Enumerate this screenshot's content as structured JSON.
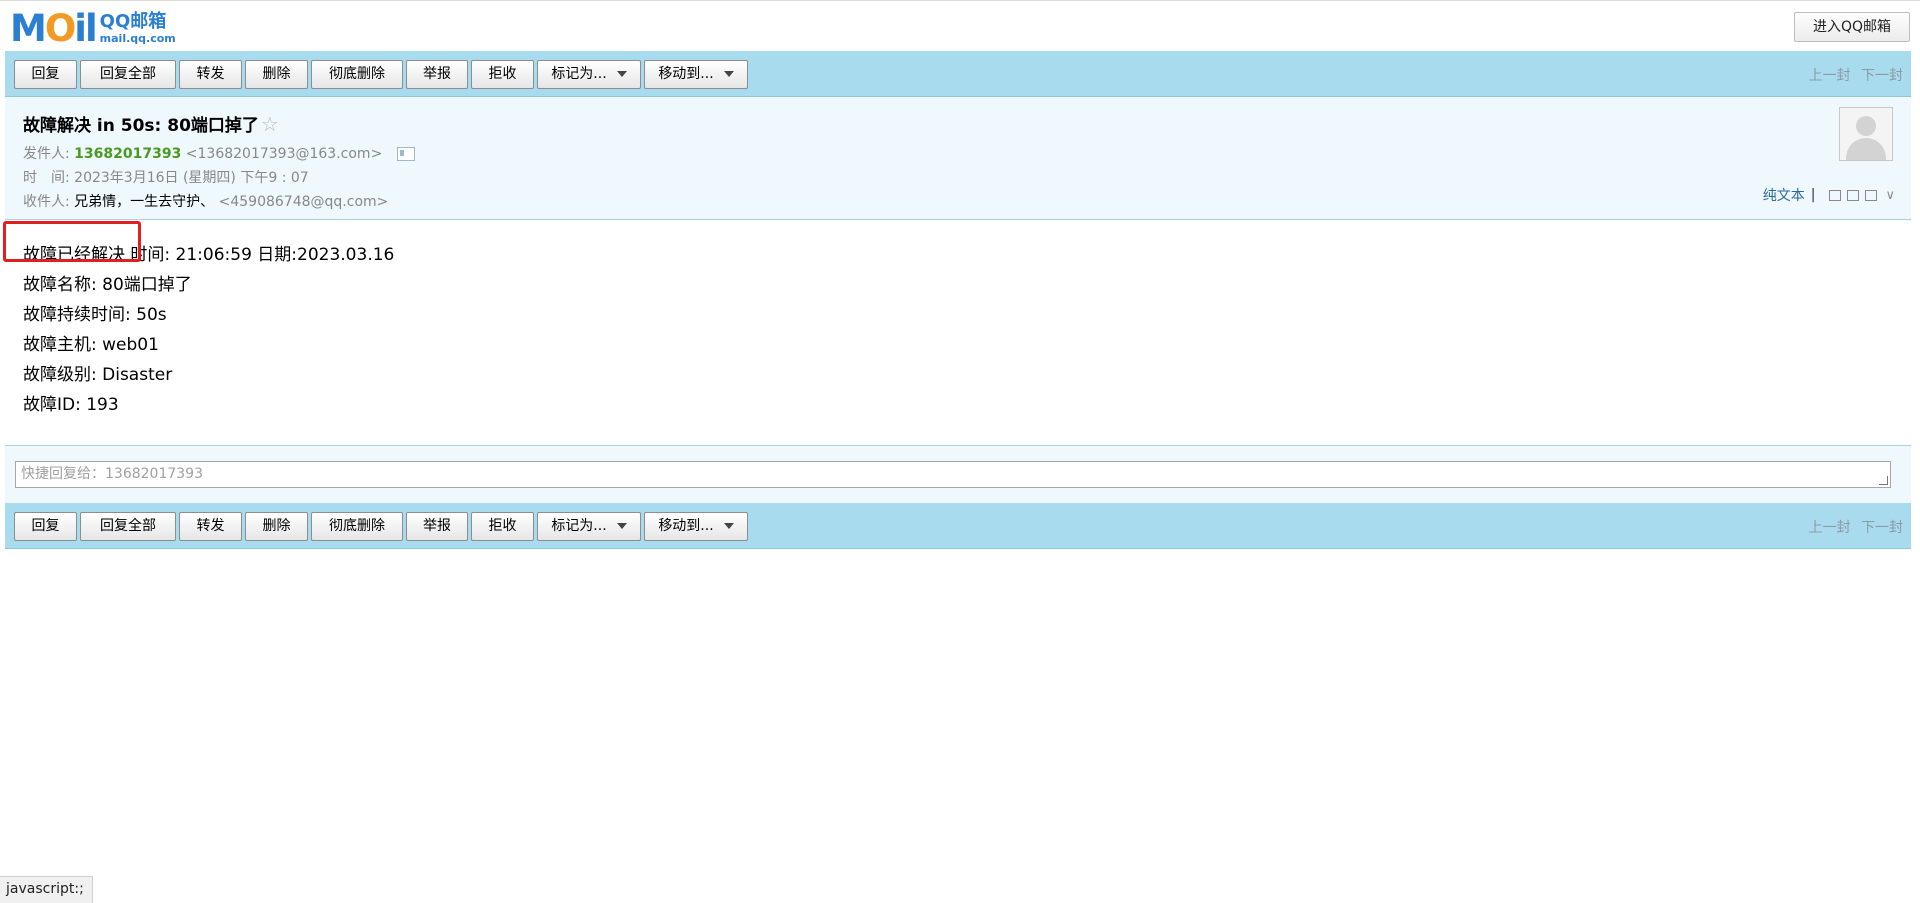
{
  "logo": {
    "text_a": "M",
    "text_o": "O",
    "text_b": "il",
    "qq": "QQ邮箱",
    "url": "mail.qq.com"
  },
  "enter_button": "进入QQ邮箱",
  "toolbar": {
    "reply": "回复",
    "reply_all": "回复全部",
    "forward": "转发",
    "delete": "删除",
    "delete_permanent": "彻底删除",
    "report": "举报",
    "reject": "拒收",
    "mark_as": "标记为...",
    "move_to": "移动到...",
    "prev": "上一封",
    "next": "下一封"
  },
  "mail": {
    "subject": "故障解决 in 50s: 80端口掉了",
    "star": "☆",
    "sender_label": "发件人:",
    "sender_name": "13682017393",
    "sender_email": "<13682017393@163.com>",
    "time_label": "时　间:",
    "time_value": "2023年3月16日 (星期四) 下午9 : 07",
    "recipient_label": "收件人:",
    "recipient_name": "兄弟情，一生去守护、",
    "recipient_email": "<459086748@qq.com>",
    "plain_text": "纯文本",
    "sep": "|"
  },
  "body_lines": {
    "line1": "故障已经解决 时间: 21:06:59 日期:2023.03.16",
    "line2": "故障名称: 80端口掉了",
    "line3": "故障持续时间: 50s",
    "line4": "故障主机: web01",
    "line5": "故障级别: Disaster",
    "line6": "故障ID: 193"
  },
  "quick_reply": {
    "placeholder": "快捷回复给：13682017393"
  },
  "status_bar": "javascript:;",
  "colors": {
    "toolbar_bg": "#a9dbef",
    "header_bg": "#eef8fd",
    "sender_green": "#4a9a1f",
    "highlight_red": "#e02020"
  }
}
